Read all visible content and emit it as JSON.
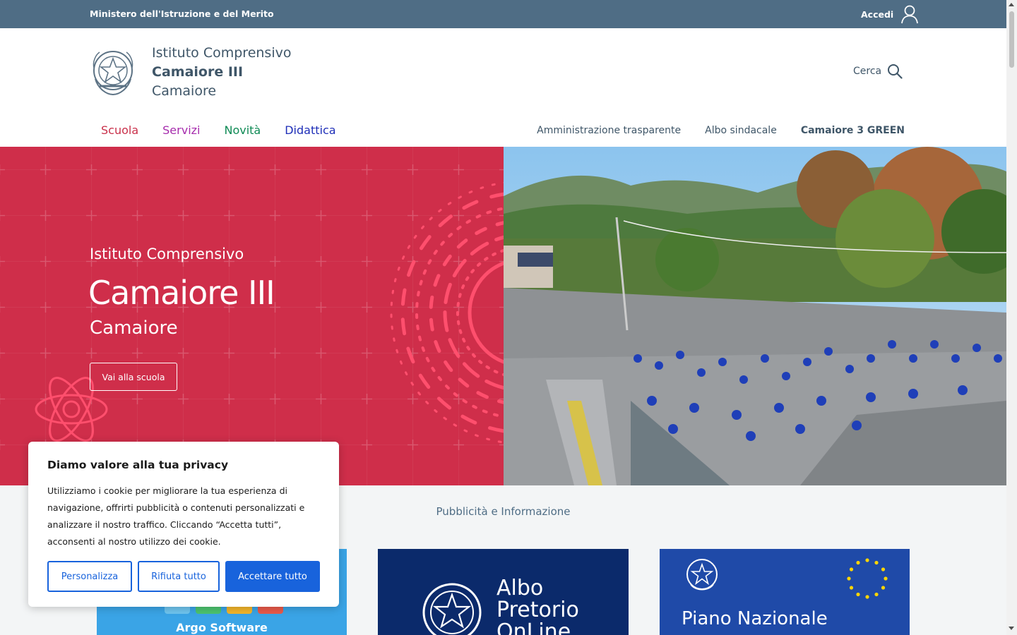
{
  "topbar": {
    "ministry": "Ministero dell'Istruzione e del Merito",
    "login_label": "Accedi"
  },
  "header": {
    "school_type": "Istituto Comprensivo",
    "school_name": "Camaiore III",
    "school_city": "Camaiore",
    "search_label": "Cerca"
  },
  "nav": {
    "main": [
      {
        "label": "Scuola",
        "color": "#c9304a"
      },
      {
        "label": "Servizi",
        "color": "#a62cad"
      },
      {
        "label": "Novità",
        "color": "#0f8a55"
      },
      {
        "label": "Didattica",
        "color": "#1f2fb8"
      }
    ],
    "secondary": [
      "Amministrazione trasparente",
      "Albo sindacale",
      "Camaiore 3 GREEN"
    ]
  },
  "hero": {
    "subtitle": "Istituto Comprensivo",
    "title": "Camaiore III",
    "city": "Camaiore",
    "button": "Vai alla scuola",
    "bg_color": "#cf2e4a"
  },
  "section": {
    "heading": "Pubblicità e Informazione",
    "cards": [
      {
        "label": "Argo Software"
      },
      {
        "line1": "Albo",
        "line2": "Pretorio",
        "line3": "OnLine"
      },
      {
        "label": "Piano Nazionale"
      }
    ]
  },
  "cookie": {
    "title": "Diamo valore alla tua privacy",
    "text": "Utilizziamo i cookie per migliorare la tua esperienza di navigazione, offrirti pubblicità o contenuti personalizzati e analizzare il nostro traffico. Cliccando “Accetta tutti”, acconsenti al nostro utilizzo dei cookie.",
    "customize": "Personalizza",
    "reject": "Rifiuta tutto",
    "accept": "Accettare tutto",
    "accent": "#1863dc"
  }
}
